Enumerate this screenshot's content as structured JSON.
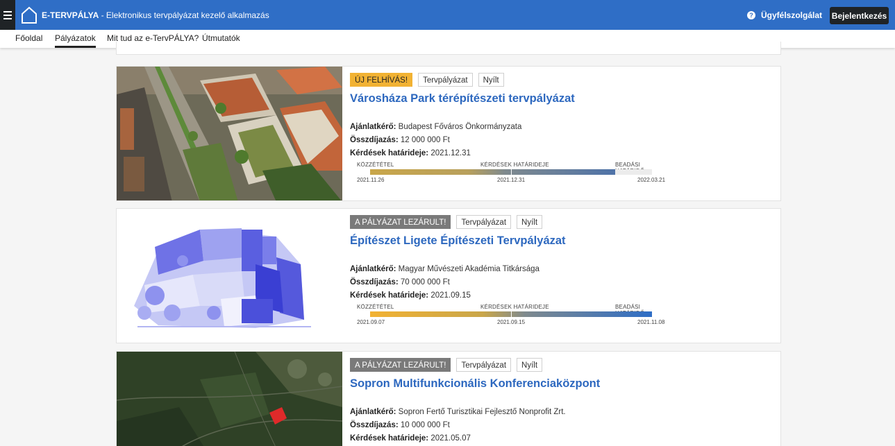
{
  "header": {
    "app_name": "E-TERVPÁLYA",
    "app_subtitle": " - Elektronikus tervpályázat kezelő alkalmazás",
    "help_label": "Ügyfélszolgálat",
    "login_label": "Bejelentkezés"
  },
  "nav": [
    {
      "label": "Főoldal"
    },
    {
      "label": "Pályázatok"
    },
    {
      "label": "Mit tud az e-TervPÁLYA?"
    },
    {
      "label": "Útmutatók"
    }
  ],
  "labels": {
    "requester": "Ajánlatkérő:",
    "prize": "Összdíjazás:",
    "deadline": "Kérdések határideje:",
    "tl_published": "Közzététel",
    "tl_questions": "Kérdések határideje",
    "tl_submission": "Beadási határidő"
  },
  "cards": [
    {
      "badge_status": "ÚJ FELHÍVÁS!",
      "badge_type": "Tervpályázat",
      "badge_access": "Nyílt",
      "title": "Városháza Park térépítészeti tervpályázat",
      "requester": "Budapest Főváros Önkormányzata",
      "prize": "12 000 000 Ft",
      "deadline": "2021.12.31",
      "date_published": "2021.11.26",
      "date_questions": "2021.12.31",
      "date_submission": "2022.03.21",
      "progress": 0.87
    },
    {
      "badge_status": "A PÁLYÁZAT LEZÁRULT!",
      "badge_type": "Tervpályázat",
      "badge_access": "Nyílt",
      "title": "Építészet Ligete Építészeti Tervpályázat",
      "requester": "Magyar Művészeti Akadémia Titkársága",
      "prize": "70 000 000 Ft",
      "deadline": "2021.09.15",
      "date_published": "2021.09.07",
      "date_questions": "2021.09.15",
      "date_submission": "2021.11.08",
      "progress": 1.0
    },
    {
      "badge_status": "A PÁLYÁZAT LEZÁRULT!",
      "badge_type": "Tervpályázat",
      "badge_access": "Nyílt",
      "title": "Sopron Multifunkcionális Konferenciaközpont",
      "requester": "Sopron Fertő Turisztikai Fejlesztő Nonprofit Zrt.",
      "prize": "10 000 000 Ft",
      "deadline": "2021.05.07"
    }
  ],
  "colors": {
    "header_bg": "#2f6ec6",
    "accent_blue": "#2d68bf",
    "new_badge": "#f2b233",
    "closed_badge": "#7a7a7a"
  }
}
